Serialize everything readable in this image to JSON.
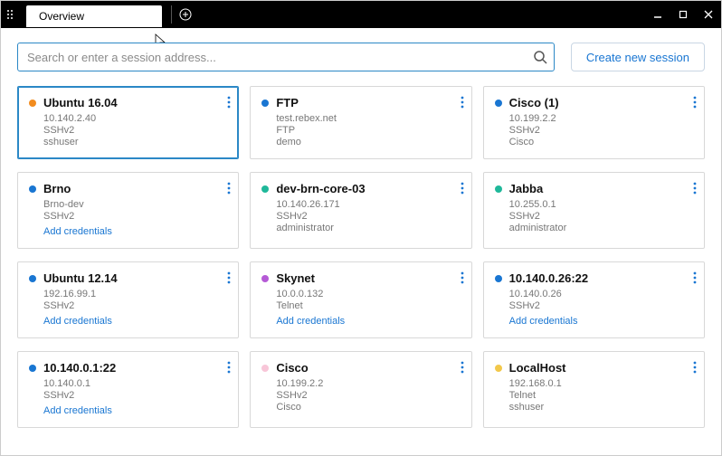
{
  "titlebar": {
    "tab_label": "Overview"
  },
  "toolbar": {
    "search_placeholder": "Search or enter a session address...",
    "new_session_label": "Create new session",
    "add_credentials_label": "Add credentials"
  },
  "sessions": [
    {
      "name": "Ubuntu 16.04",
      "dot": "#f28c1e",
      "selected": true,
      "lines": [
        "10.140.2.40",
        "SSHv2",
        "sshuser"
      ],
      "add_credentials": false
    },
    {
      "name": "FTP",
      "dot": "#1976d2",
      "selected": false,
      "lines": [
        "test.rebex.net",
        "FTP",
        "demo"
      ],
      "add_credentials": false
    },
    {
      "name": "Cisco (1)",
      "dot": "#1976d2",
      "selected": false,
      "lines": [
        "10.199.2.2",
        "SSHv2",
        "Cisco"
      ],
      "add_credentials": false
    },
    {
      "name": "Brno",
      "dot": "#1976d2",
      "selected": false,
      "lines": [
        "Brno-dev",
        "SSHv2"
      ],
      "add_credentials": true
    },
    {
      "name": "dev-brn-core-03",
      "dot": "#1fb89a",
      "selected": false,
      "lines": [
        "10.140.26.171",
        "SSHv2",
        "administrator"
      ],
      "add_credentials": false
    },
    {
      "name": "Jabba",
      "dot": "#1fb89a",
      "selected": false,
      "lines": [
        "10.255.0.1",
        "SSHv2",
        "administrator"
      ],
      "add_credentials": false
    },
    {
      "name": "Ubuntu 12.14",
      "dot": "#1976d2",
      "selected": false,
      "lines": [
        "192.16.99.1",
        "SSHv2"
      ],
      "add_credentials": true
    },
    {
      "name": "Skynet",
      "dot": "#b55ad6",
      "selected": false,
      "lines": [
        "10.0.0.132",
        "Telnet"
      ],
      "add_credentials": true
    },
    {
      "name": "10.140.0.26:22",
      "dot": "#1976d2",
      "selected": false,
      "lines": [
        "10.140.0.26",
        "SSHv2"
      ],
      "add_credentials": true
    },
    {
      "name": "10.140.0.1:22",
      "dot": "#1976d2",
      "selected": false,
      "lines": [
        "10.140.0.1",
        "SSHv2"
      ],
      "add_credentials": true
    },
    {
      "name": "Cisco",
      "dot": "#f8c6d8",
      "selected": false,
      "lines": [
        "10.199.2.2",
        "SSHv2",
        "Cisco"
      ],
      "add_credentials": false
    },
    {
      "name": "LocalHost",
      "dot": "#f2c84b",
      "selected": false,
      "lines": [
        "192.168.0.1",
        "Telnet",
        "sshuser"
      ],
      "add_credentials": false
    }
  ]
}
